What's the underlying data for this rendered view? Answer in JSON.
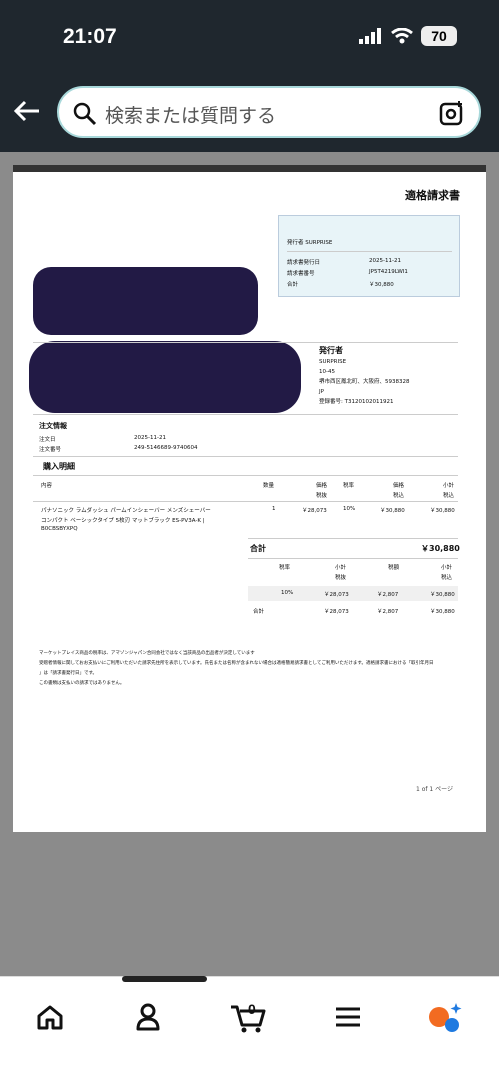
{
  "status": {
    "time": "21:07",
    "battery": "70"
  },
  "search": {
    "placeholder": "検索または質問する"
  },
  "doc": {
    "title": "適格請求書",
    "info_box": {
      "issuer": "発行者 SURPRISE",
      "rows": [
        {
          "label": "請求書発行日",
          "value": "2025-11-21"
        },
        {
          "label": "請求書番号",
          "value": "JP5T4219LWI1"
        },
        {
          "label": "合計",
          "value": "￥30,880"
        }
      ]
    },
    "issuer": {
      "heading": "発行者",
      "lines": [
        "SURPRISE",
        "10-45",
        "堺市西区鳳北町、大阪府、5938328",
        "JP",
        "登録番号: T3120102011921"
      ]
    },
    "order": {
      "title": "注文情報",
      "date_label": "注文日",
      "date": "2025-11-21",
      "number_label": "注文番号",
      "number": "249-5146689-9740604"
    },
    "details": {
      "title": "購入明細",
      "headers": {
        "content": "内容",
        "qty": "数量",
        "price": "価格",
        "price_sub": "税抜",
        "tax_rate": "税率",
        "price2": "価格",
        "price2_sub": "税込",
        "subtotal": "小計",
        "subtotal_sub": "税込"
      },
      "item": {
        "line1": "パナソニック ラムダッシュ パームインシェーバー メンズシェーバー",
        "line2": "コンパクト ベーシックタイプ 5枚刃 マットブラック ES-PV3A-K |",
        "line3": "B0CBSBYXPQ",
        "qty": "1",
        "price": "￥28,073",
        "rate": "10%",
        "price_incl": "￥30,880",
        "subtotal": "￥30,880"
      }
    },
    "total": {
      "label": "合計",
      "value": "￥30,880"
    },
    "tax_table": {
      "h_rate": "税率",
      "h_sub": "小計",
      "h_sub_sub": "税抜",
      "h_tax": "税額",
      "h_sub2": "小計",
      "h_sub2_sub": "税込",
      "row": {
        "rate": "10%",
        "sub": "￥28,073",
        "tax": "￥2,807",
        "sub2": "￥30,880"
      },
      "sum": {
        "label": "合計",
        "sub": "￥28,073",
        "tax": "￥2,807",
        "sub2": "￥30,880"
      }
    },
    "notes": [
      "マーケットプレイス商品の税率は、アマゾンジャパン合同会社ではなく当該商品の出品者が決定しています",
      "受贈者情報に関しておお支払いにご利用いただいた請求先住所を表示しています。氏名または名称が含まれない場合は適格簡易請求書としてご利用いただけます。適格請求書における「取引年月日",
      "」は「請求書発行日」です。",
      "この書類は支払いの請求ではありません。"
    ],
    "page_count": "1 of 1 ページ"
  }
}
